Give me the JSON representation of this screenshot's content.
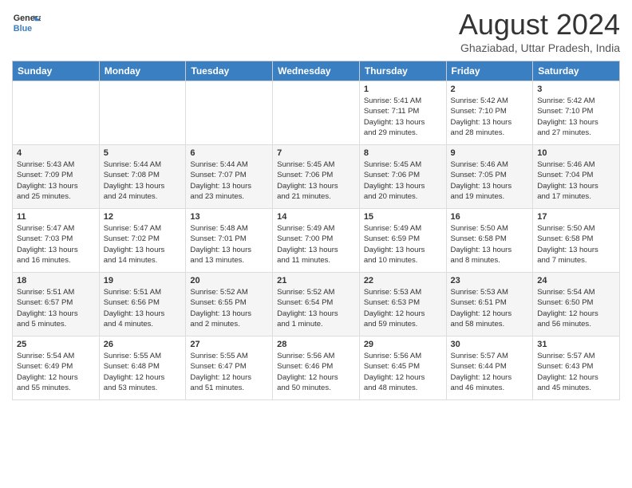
{
  "header": {
    "logo_line1": "General",
    "logo_line2": "Blue",
    "month_year": "August 2024",
    "location": "Ghaziabad, Uttar Pradesh, India"
  },
  "days_of_week": [
    "Sunday",
    "Monday",
    "Tuesday",
    "Wednesday",
    "Thursday",
    "Friday",
    "Saturday"
  ],
  "weeks": [
    [
      {
        "day": "",
        "content": ""
      },
      {
        "day": "",
        "content": ""
      },
      {
        "day": "",
        "content": ""
      },
      {
        "day": "",
        "content": ""
      },
      {
        "day": "1",
        "content": "Sunrise: 5:41 AM\nSunset: 7:11 PM\nDaylight: 13 hours\nand 29 minutes."
      },
      {
        "day": "2",
        "content": "Sunrise: 5:42 AM\nSunset: 7:10 PM\nDaylight: 13 hours\nand 28 minutes."
      },
      {
        "day": "3",
        "content": "Sunrise: 5:42 AM\nSunset: 7:10 PM\nDaylight: 13 hours\nand 27 minutes."
      }
    ],
    [
      {
        "day": "4",
        "content": "Sunrise: 5:43 AM\nSunset: 7:09 PM\nDaylight: 13 hours\nand 25 minutes."
      },
      {
        "day": "5",
        "content": "Sunrise: 5:44 AM\nSunset: 7:08 PM\nDaylight: 13 hours\nand 24 minutes."
      },
      {
        "day": "6",
        "content": "Sunrise: 5:44 AM\nSunset: 7:07 PM\nDaylight: 13 hours\nand 23 minutes."
      },
      {
        "day": "7",
        "content": "Sunrise: 5:45 AM\nSunset: 7:06 PM\nDaylight: 13 hours\nand 21 minutes."
      },
      {
        "day": "8",
        "content": "Sunrise: 5:45 AM\nSunset: 7:06 PM\nDaylight: 13 hours\nand 20 minutes."
      },
      {
        "day": "9",
        "content": "Sunrise: 5:46 AM\nSunset: 7:05 PM\nDaylight: 13 hours\nand 19 minutes."
      },
      {
        "day": "10",
        "content": "Sunrise: 5:46 AM\nSunset: 7:04 PM\nDaylight: 13 hours\nand 17 minutes."
      }
    ],
    [
      {
        "day": "11",
        "content": "Sunrise: 5:47 AM\nSunset: 7:03 PM\nDaylight: 13 hours\nand 16 minutes."
      },
      {
        "day": "12",
        "content": "Sunrise: 5:47 AM\nSunset: 7:02 PM\nDaylight: 13 hours\nand 14 minutes."
      },
      {
        "day": "13",
        "content": "Sunrise: 5:48 AM\nSunset: 7:01 PM\nDaylight: 13 hours\nand 13 minutes."
      },
      {
        "day": "14",
        "content": "Sunrise: 5:49 AM\nSunset: 7:00 PM\nDaylight: 13 hours\nand 11 minutes."
      },
      {
        "day": "15",
        "content": "Sunrise: 5:49 AM\nSunset: 6:59 PM\nDaylight: 13 hours\nand 10 minutes."
      },
      {
        "day": "16",
        "content": "Sunrise: 5:50 AM\nSunset: 6:58 PM\nDaylight: 13 hours\nand 8 minutes."
      },
      {
        "day": "17",
        "content": "Sunrise: 5:50 AM\nSunset: 6:58 PM\nDaylight: 13 hours\nand 7 minutes."
      }
    ],
    [
      {
        "day": "18",
        "content": "Sunrise: 5:51 AM\nSunset: 6:57 PM\nDaylight: 13 hours\nand 5 minutes."
      },
      {
        "day": "19",
        "content": "Sunrise: 5:51 AM\nSunset: 6:56 PM\nDaylight: 13 hours\nand 4 minutes."
      },
      {
        "day": "20",
        "content": "Sunrise: 5:52 AM\nSunset: 6:55 PM\nDaylight: 13 hours\nand 2 minutes."
      },
      {
        "day": "21",
        "content": "Sunrise: 5:52 AM\nSunset: 6:54 PM\nDaylight: 13 hours\nand 1 minute."
      },
      {
        "day": "22",
        "content": "Sunrise: 5:53 AM\nSunset: 6:53 PM\nDaylight: 12 hours\nand 59 minutes."
      },
      {
        "day": "23",
        "content": "Sunrise: 5:53 AM\nSunset: 6:51 PM\nDaylight: 12 hours\nand 58 minutes."
      },
      {
        "day": "24",
        "content": "Sunrise: 5:54 AM\nSunset: 6:50 PM\nDaylight: 12 hours\nand 56 minutes."
      }
    ],
    [
      {
        "day": "25",
        "content": "Sunrise: 5:54 AM\nSunset: 6:49 PM\nDaylight: 12 hours\nand 55 minutes."
      },
      {
        "day": "26",
        "content": "Sunrise: 5:55 AM\nSunset: 6:48 PM\nDaylight: 12 hours\nand 53 minutes."
      },
      {
        "day": "27",
        "content": "Sunrise: 5:55 AM\nSunset: 6:47 PM\nDaylight: 12 hours\nand 51 minutes."
      },
      {
        "day": "28",
        "content": "Sunrise: 5:56 AM\nSunset: 6:46 PM\nDaylight: 12 hours\nand 50 minutes."
      },
      {
        "day": "29",
        "content": "Sunrise: 5:56 AM\nSunset: 6:45 PM\nDaylight: 12 hours\nand 48 minutes."
      },
      {
        "day": "30",
        "content": "Sunrise: 5:57 AM\nSunset: 6:44 PM\nDaylight: 12 hours\nand 46 minutes."
      },
      {
        "day": "31",
        "content": "Sunrise: 5:57 AM\nSunset: 6:43 PM\nDaylight: 12 hours\nand 45 minutes."
      }
    ]
  ]
}
